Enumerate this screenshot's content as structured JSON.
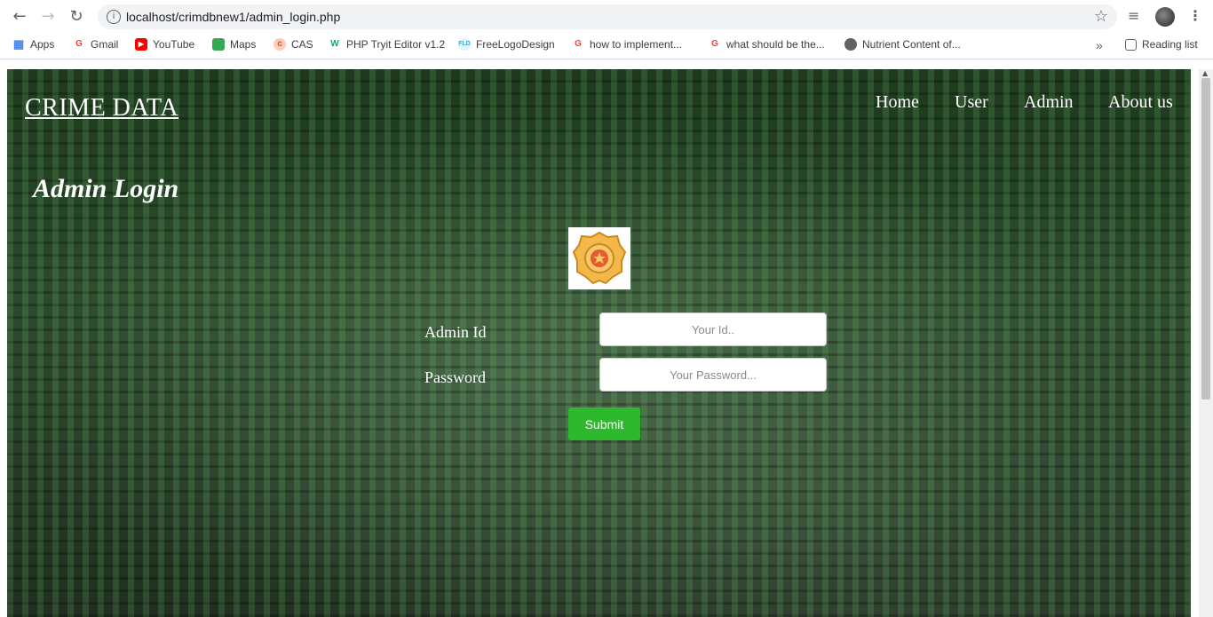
{
  "browser": {
    "url": "localhost/crimdbnew1/admin_login.php",
    "bookmarks": [
      {
        "label": "Apps",
        "icon": "apps-grid-icon",
        "color": "#4285f4"
      },
      {
        "label": "Gmail",
        "icon": "google-icon",
        "color": "#ea4335"
      },
      {
        "label": "YouTube",
        "icon": "youtube-icon",
        "color": "#ff0000"
      },
      {
        "label": "Maps",
        "icon": "maps-icon",
        "color": "#34a853"
      },
      {
        "label": "CAS",
        "icon": "cas-icon",
        "color": "#e65100"
      },
      {
        "label": "PHP Tryit Editor v1.2",
        "icon": "w3schools-icon",
        "color": "#04aa6d"
      },
      {
        "label": "FreeLogoDesign",
        "icon": "freelogodesign-icon",
        "color": "#29b6f6"
      },
      {
        "label": "how to implement...",
        "icon": "google-icon",
        "color": "#ea4335"
      },
      {
        "label": "what should be the...",
        "icon": "google-icon",
        "color": "#ea4335"
      },
      {
        "label": "Nutrient Content of...",
        "icon": "globe-icon",
        "color": "#5f6368"
      }
    ],
    "reading_list": "Reading list"
  },
  "site": {
    "brand": "CRIME DATA",
    "nav": [
      "Home",
      "User",
      "Admin",
      "About us"
    ]
  },
  "login": {
    "heading": "Admin Login",
    "id_label": "Admin Id",
    "id_placeholder": "Your Id..",
    "password_label": "Password",
    "password_placeholder": "Your Password...",
    "submit_label": "Submit"
  },
  "colors": {
    "submit": "#2db82d",
    "background": "#1d3a1d"
  }
}
